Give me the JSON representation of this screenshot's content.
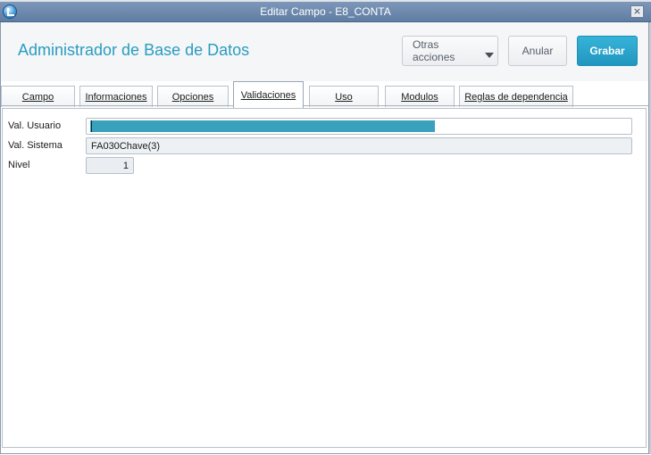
{
  "window": {
    "title": "Editar Campo - E8_CONTA",
    "close_glyph": "×"
  },
  "header": {
    "app_title": "Administrador de Base de Datos",
    "buttons": {
      "otras_acciones": "Otras acciones",
      "anular": "Anular",
      "grabar": "Grabar"
    }
  },
  "tabs": [
    {
      "label": "Campo",
      "active": false
    },
    {
      "label": "Informaciones",
      "active": false
    },
    {
      "label": "Opciones",
      "active": false
    },
    {
      "label": "Validaciones",
      "active": true
    },
    {
      "label": "Uso",
      "active": false
    },
    {
      "label": "Modulos",
      "active": false
    },
    {
      "label": "Reglas de dependencia",
      "active": false
    }
  ],
  "form": {
    "val_usuario": {
      "label": "Val. Usuario",
      "value": ""
    },
    "val_sistema": {
      "label": "Val. Sistema",
      "value": "FA030Chave(3)"
    },
    "nivel": {
      "label": "Nivel",
      "value": "1"
    }
  },
  "colors": {
    "accent": "#2a9cbf",
    "grabar_bg": "#2196bf",
    "selection": "#3aa1bd",
    "titlebar": "#6b87ab"
  },
  "icons": {
    "app": "app-logo-icon",
    "close": "close-icon",
    "dropdown": "caret-down-icon"
  }
}
